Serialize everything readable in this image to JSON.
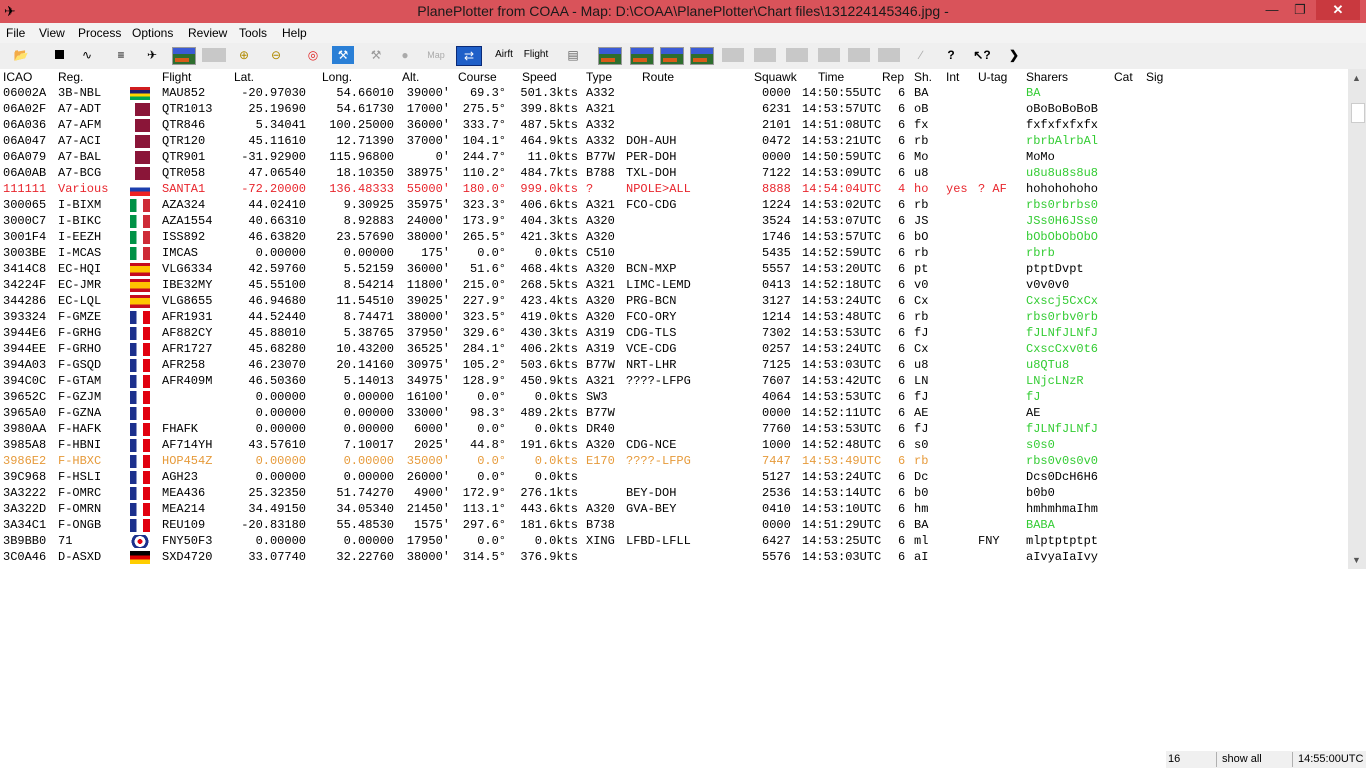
{
  "window": {
    "title": "PlanePlotter from COAA - Map: D:\\COAA\\PlanePlotter\\Chart files\\131224145346.jpg -"
  },
  "menu": [
    "File",
    "View",
    "Process",
    "Options",
    "Review",
    "Tools",
    "Help"
  ],
  "toolbar": {
    "airframe_label": "Airft",
    "flight_label": "Flight",
    "map_label": "Map"
  },
  "columns": [
    "ICAO",
    "Reg.",
    "Flight",
    "Lat.",
    "Long.",
    "Alt.",
    "Course",
    "Speed",
    "Type",
    "Route",
    "Squawk",
    "Time",
    "Rep",
    "Sh.",
    "Int",
    "U-tag",
    "Sharers",
    "Cat",
    "Sig"
  ],
  "colors": {
    "normal": "#000000",
    "red": "#e8262d",
    "orange": "#e69a3a",
    "green": "#33cc33",
    "title_bar": "#d9535a"
  },
  "rows": [
    {
      "icao": "06002A",
      "reg": "3B-NBL",
      "flight": "MAU852",
      "lat": "-20.97030",
      "lon": "54.66010",
      "alt": "39000'",
      "course": "69.3°",
      "speed": "501.3kts",
      "type": "A332",
      "route": "",
      "squawk": "0000",
      "time": "14:50:55UTC",
      "rep": "6",
      "sh": "BA",
      "int": "",
      "utag": "",
      "sharers": "BA",
      "color": "normal",
      "sharers_color": "green",
      "flag": "mauritius"
    },
    {
      "icao": "06A02F",
      "reg": "A7-ADT",
      "flight": "QTR1013",
      "lat": "25.19690",
      "lon": "54.61730",
      "alt": "17000'",
      "course": "275.5°",
      "speed": "399.8kts",
      "type": "A321",
      "route": "",
      "squawk": "6231",
      "time": "14:53:57UTC",
      "rep": "6",
      "sh": "oB",
      "int": "",
      "utag": "",
      "sharers": "oBoBoBoBoB",
      "color": "normal",
      "sharers_color": "normal",
      "flag": "qatar"
    },
    {
      "icao": "06A036",
      "reg": "A7-AFM",
      "flight": "QTR846",
      "lat": "5.34041",
      "lon": "100.25000",
      "alt": "36000'",
      "course": "333.7°",
      "speed": "487.5kts",
      "type": "A332",
      "route": "",
      "squawk": "2101",
      "time": "14:51:08UTC",
      "rep": "6",
      "sh": "fx",
      "int": "",
      "utag": "",
      "sharers": "fxfxfxfxfx",
      "color": "normal",
      "sharers_color": "normal",
      "flag": "qatar"
    },
    {
      "icao": "06A047",
      "reg": "A7-ACI",
      "flight": "QTR120",
      "lat": "45.11610",
      "lon": "12.71390",
      "alt": "37000'",
      "course": "104.1°",
      "speed": "464.9kts",
      "type": "A332",
      "route": "DOH-AUH",
      "squawk": "0472",
      "time": "14:53:21UTC",
      "rep": "6",
      "sh": "rb",
      "int": "",
      "utag": "",
      "sharers": "rbrbAlrbAl",
      "color": "normal",
      "sharers_color": "green",
      "flag": "qatar"
    },
    {
      "icao": "06A079",
      "reg": "A7-BAL",
      "flight": "QTR901",
      "lat": "-31.92900",
      "lon": "115.96800",
      "alt": "0'",
      "course": "244.7°",
      "speed": "11.0kts",
      "type": "B77W",
      "route": "PER-DOH",
      "squawk": "0000",
      "time": "14:50:59UTC",
      "rep": "6",
      "sh": "Mo",
      "int": "",
      "utag": "",
      "sharers": "MoMo",
      "color": "normal",
      "sharers_color": "normal",
      "flag": "qatar"
    },
    {
      "icao": "06A0AB",
      "reg": "A7-BCG",
      "flight": "QTR058",
      "lat": "47.06540",
      "lon": "18.10350",
      "alt": "38975'",
      "course": "110.2°",
      "speed": "484.7kts",
      "type": "B788",
      "route": "TXL-DOH",
      "squawk": "7122",
      "time": "14:53:09UTC",
      "rep": "6",
      "sh": "u8",
      "int": "",
      "utag": "",
      "sharers": "u8u8u8s8u8",
      "color": "normal",
      "sharers_color": "green",
      "flag": "qatar"
    },
    {
      "icao": "111111",
      "reg": "Various",
      "flight": "SANTA1",
      "lat": "-72.20000",
      "lon": "136.48333",
      "alt": "55000'",
      "course": "180.0°",
      "speed": "999.0kts",
      "type": "?",
      "route": "NPOLE>ALL",
      "squawk": "8888",
      "time": "14:54:04UTC",
      "rep": "4",
      "sh": "ho",
      "int": "yes",
      "utag": "? AF",
      "sharers": "hohohohoho",
      "color": "red",
      "sharers_color": "normal",
      "flag": "russia"
    },
    {
      "icao": "300065",
      "reg": "I-BIXM",
      "flight": "AZA324",
      "lat": "44.02410",
      "lon": "9.30925",
      "alt": "35975'",
      "course": "323.3°",
      "speed": "406.6kts",
      "type": "A321",
      "route": "FCO-CDG",
      "squawk": "1224",
      "time": "14:53:02UTC",
      "rep": "6",
      "sh": "rb",
      "int": "",
      "utag": "",
      "sharers": "rbs0rbrbs0",
      "color": "normal",
      "sharers_color": "green",
      "flag": "italy"
    },
    {
      "icao": "3000C7",
      "reg": "I-BIKC",
      "flight": "AZA1554",
      "lat": "40.66310",
      "lon": "8.92883",
      "alt": "24000'",
      "course": "173.9°",
      "speed": "404.3kts",
      "type": "A320",
      "route": "",
      "squawk": "3524",
      "time": "14:53:07UTC",
      "rep": "6",
      "sh": "JS",
      "int": "",
      "utag": "",
      "sharers": "JSs0H6JSs0",
      "color": "normal",
      "sharers_color": "green",
      "flag": "italy"
    },
    {
      "icao": "3001F4",
      "reg": "I-EEZH",
      "flight": "ISS892",
      "lat": "46.63820",
      "lon": "23.57690",
      "alt": "38000'",
      "course": "265.5°",
      "speed": "421.3kts",
      "type": "A320",
      "route": "",
      "squawk": "1746",
      "time": "14:53:57UTC",
      "rep": "6",
      "sh": "bO",
      "int": "",
      "utag": "",
      "sharers": "bObObObObO",
      "color": "normal",
      "sharers_color": "green",
      "flag": "italy"
    },
    {
      "icao": "3003BE",
      "reg": "I-MCAS",
      "flight": "IMCAS",
      "lat": "0.00000",
      "lon": "0.00000",
      "alt": "175'",
      "course": "0.0°",
      "speed": "0.0kts",
      "type": "C510",
      "route": "",
      "squawk": "5435",
      "time": "14:52:59UTC",
      "rep": "6",
      "sh": "rb",
      "int": "",
      "utag": "",
      "sharers": "rbrb",
      "color": "normal",
      "sharers_color": "green",
      "flag": "italy"
    },
    {
      "icao": "3414C8",
      "reg": "EC-HQI",
      "flight": "VLG6334",
      "lat": "42.59760",
      "lon": "5.52159",
      "alt": "36000'",
      "course": "51.6°",
      "speed": "468.4kts",
      "type": "A320",
      "route": "BCN-MXP",
      "squawk": "5557",
      "time": "14:53:20UTC",
      "rep": "6",
      "sh": "pt",
      "int": "",
      "utag": "",
      "sharers": "ptptDvpt",
      "color": "normal",
      "sharers_color": "normal",
      "flag": "spain"
    },
    {
      "icao": "34224F",
      "reg": "EC-JMR",
      "flight": "IBE32MY",
      "lat": "45.55100",
      "lon": "8.54214",
      "alt": "11800'",
      "course": "215.0°",
      "speed": "268.5kts",
      "type": "A321",
      "route": "LIMC-LEMD",
      "squawk": "0413",
      "time": "14:52:18UTC",
      "rep": "6",
      "sh": "v0",
      "int": "",
      "utag": "",
      "sharers": "v0v0v0",
      "color": "normal",
      "sharers_color": "normal",
      "flag": "spain"
    },
    {
      "icao": "344286",
      "reg": "EC-LQL",
      "flight": "VLG8655",
      "lat": "46.94680",
      "lon": "11.54510",
      "alt": "39025'",
      "course": "227.9°",
      "speed": "423.4kts",
      "type": "A320",
      "route": "PRG-BCN",
      "squawk": "3127",
      "time": "14:53:24UTC",
      "rep": "6",
      "sh": "Cx",
      "int": "",
      "utag": "",
      "sharers": "Cxscj5CxCx",
      "color": "normal",
      "sharers_color": "green",
      "flag": "spain"
    },
    {
      "icao": "393324",
      "reg": "F-GMZE",
      "flight": "AFR1931",
      "lat": "44.52440",
      "lon": "8.74471",
      "alt": "38000'",
      "course": "323.5°",
      "speed": "419.0kts",
      "type": "A320",
      "route": "FCO-ORY",
      "squawk": "1214",
      "time": "14:53:48UTC",
      "rep": "6",
      "sh": "rb",
      "int": "",
      "utag": "",
      "sharers": "rbs0rbv0rb",
      "color": "normal",
      "sharers_color": "green",
      "flag": "france"
    },
    {
      "icao": "3944E6",
      "reg": "F-GRHG",
      "flight": "AF882CY",
      "lat": "45.88010",
      "lon": "5.38765",
      "alt": "37950'",
      "course": "329.6°",
      "speed": "430.3kts",
      "type": "A319",
      "route": "CDG-TLS",
      "squawk": "7302",
      "time": "14:53:53UTC",
      "rep": "6",
      "sh": "fJ",
      "int": "",
      "utag": "",
      "sharers": "fJLNfJLNfJ",
      "color": "normal",
      "sharers_color": "green",
      "flag": "france"
    },
    {
      "icao": "3944EE",
      "reg": "F-GRHO",
      "flight": "AFR1727",
      "lat": "45.68280",
      "lon": "10.43200",
      "alt": "36525'",
      "course": "284.1°",
      "speed": "406.2kts",
      "type": "A319",
      "route": "VCE-CDG",
      "squawk": "0257",
      "time": "14:53:24UTC",
      "rep": "6",
      "sh": "Cx",
      "int": "",
      "utag": "",
      "sharers": "CxscCxv0t6",
      "color": "normal",
      "sharers_color": "green",
      "flag": "france"
    },
    {
      "icao": "394A03",
      "reg": "F-GSQD",
      "flight": "AFR258",
      "lat": "46.23070",
      "lon": "20.14160",
      "alt": "30975'",
      "course": "105.2°",
      "speed": "503.6kts",
      "type": "B77W",
      "route": "NRT-LHR",
      "squawk": "7125",
      "time": "14:53:03UTC",
      "rep": "6",
      "sh": "u8",
      "int": "",
      "utag": "",
      "sharers": "u8QTu8",
      "color": "normal",
      "sharers_color": "green",
      "flag": "france"
    },
    {
      "icao": "394C0C",
      "reg": "F-GTAM",
      "flight": "AFR409M",
      "lat": "46.50360",
      "lon": "5.14013",
      "alt": "34975'",
      "course": "128.9°",
      "speed": "450.9kts",
      "type": "A321",
      "route": "????-LFPG",
      "squawk": "7607",
      "time": "14:53:42UTC",
      "rep": "6",
      "sh": "LN",
      "int": "",
      "utag": "",
      "sharers": "LNjcLNzR",
      "color": "normal",
      "sharers_color": "green",
      "flag": "france"
    },
    {
      "icao": "39652C",
      "reg": "F-GZJM",
      "flight": "",
      "lat": "0.00000",
      "lon": "0.00000",
      "alt": "16100'",
      "course": "0.0°",
      "speed": "0.0kts",
      "type": "SW3",
      "route": "",
      "squawk": "4064",
      "time": "14:53:53UTC",
      "rep": "6",
      "sh": "fJ",
      "int": "",
      "utag": "",
      "sharers": "fJ",
      "color": "normal",
      "sharers_color": "green",
      "flag": "france"
    },
    {
      "icao": "3965A0",
      "reg": "F-GZNA",
      "flight": "",
      "lat": "0.00000",
      "lon": "0.00000",
      "alt": "33000'",
      "course": "98.3°",
      "speed": "489.2kts",
      "type": "B77W",
      "route": "",
      "squawk": "0000",
      "time": "14:52:11UTC",
      "rep": "6",
      "sh": "AE",
      "int": "",
      "utag": "",
      "sharers": "AE",
      "color": "normal",
      "sharers_color": "normal",
      "flag": "france"
    },
    {
      "icao": "3980AA",
      "reg": "F-HAFK",
      "flight": "FHAFK",
      "lat": "0.00000",
      "lon": "0.00000",
      "alt": "6000'",
      "course": "0.0°",
      "speed": "0.0kts",
      "type": "DR40",
      "route": "",
      "squawk": "7760",
      "time": "14:53:53UTC",
      "rep": "6",
      "sh": "fJ",
      "int": "",
      "utag": "",
      "sharers": "fJLNfJLNfJ",
      "color": "normal",
      "sharers_color": "green",
      "flag": "france"
    },
    {
      "icao": "3985A8",
      "reg": "F-HBNI",
      "flight": "AF714YH",
      "lat": "43.57610",
      "lon": "7.10017",
      "alt": "2025'",
      "course": "44.8°",
      "speed": "191.6kts",
      "type": "A320",
      "route": "CDG-NCE",
      "squawk": "1000",
      "time": "14:52:48UTC",
      "rep": "6",
      "sh": "s0",
      "int": "",
      "utag": "",
      "sharers": "s0s0",
      "color": "normal",
      "sharers_color": "green",
      "flag": "france"
    },
    {
      "icao": "3986E2",
      "reg": "F-HBXC",
      "flight": "HOP454Z",
      "lat": "0.00000",
      "lon": "0.00000",
      "alt": "35000'",
      "course": "0.0°",
      "speed": "0.0kts",
      "type": "E170",
      "route": "????-LFPG",
      "squawk": "7447",
      "time": "14:53:49UTC",
      "rep": "6",
      "sh": "rb",
      "int": "",
      "utag": "",
      "sharers": "rbs0v0s0v0",
      "color": "orange",
      "sharers_color": "green",
      "flag": "france"
    },
    {
      "icao": "39C968",
      "reg": "F-HSLI",
      "flight": "AGH23",
      "lat": "0.00000",
      "lon": "0.00000",
      "alt": "26000'",
      "course": "0.0°",
      "speed": "0.0kts",
      "type": "",
      "route": "",
      "squawk": "5127",
      "time": "14:53:24UTC",
      "rep": "6",
      "sh": "Dc",
      "int": "",
      "utag": "",
      "sharers": "Dcs0DcH6H6",
      "color": "normal",
      "sharers_color": "normal",
      "flag": "france"
    },
    {
      "icao": "3A3222",
      "reg": "F-OMRC",
      "flight": "MEA436",
      "lat": "25.32350",
      "lon": "51.74270",
      "alt": "4900'",
      "course": "172.9°",
      "speed": "276.1kts",
      "type": "",
      "route": "BEY-DOH",
      "squawk": "2536",
      "time": "14:53:14UTC",
      "rep": "6",
      "sh": "b0",
      "int": "",
      "utag": "",
      "sharers": "b0b0",
      "color": "normal",
      "sharers_color": "normal",
      "flag": "france"
    },
    {
      "icao": "3A322D",
      "reg": "F-OMRN",
      "flight": "MEA214",
      "lat": "34.49150",
      "lon": "34.05340",
      "alt": "21450'",
      "course": "113.1°",
      "speed": "443.6kts",
      "type": "A320",
      "route": "GVA-BEY",
      "squawk": "0410",
      "time": "14:53:10UTC",
      "rep": "6",
      "sh": "hm",
      "int": "",
      "utag": "",
      "sharers": "hmhmhmaIhm",
      "color": "normal",
      "sharers_color": "normal",
      "flag": "france"
    },
    {
      "icao": "3A34C1",
      "reg": "F-ONGB",
      "flight": "REU109",
      "lat": "-20.83180",
      "lon": "55.48530",
      "alt": "1575'",
      "course": "297.6°",
      "speed": "181.6kts",
      "type": "B738",
      "route": "",
      "squawk": "0000",
      "time": "14:51:29UTC",
      "rep": "6",
      "sh": "BA",
      "int": "",
      "utag": "",
      "sharers": "BABA",
      "color": "normal",
      "sharers_color": "green",
      "flag": "france"
    },
    {
      "icao": "3B9BB0",
      "reg": "71",
      "flight": "FNY50F3",
      "lat": "0.00000",
      "lon": "0.00000",
      "alt": "17950'",
      "course": "0.0°",
      "speed": "0.0kts",
      "type": "XING",
      "route": "LFBD-LFLL",
      "squawk": "6427",
      "time": "14:53:25UTC",
      "rep": "6",
      "sh": "ml",
      "int": "",
      "utag": "FNY",
      "sharers": "mlptptptpt",
      "color": "normal",
      "sharers_color": "normal",
      "flag": "roundel"
    },
    {
      "icao": "3C0A46",
      "reg": "D-ASXD",
      "flight": "SXD4720",
      "lat": "33.07740",
      "lon": "32.22760",
      "alt": "38000'",
      "course": "314.5°",
      "speed": "376.9kts",
      "type": "",
      "route": "",
      "squawk": "5576",
      "time": "14:53:03UTC",
      "rep": "6",
      "sh": "aI",
      "int": "",
      "utag": "",
      "sharers": "aIvyaIaIvy",
      "color": "normal",
      "sharers_color": "normal",
      "flag": "germany"
    }
  ],
  "status": {
    "count": "16",
    "filter": "show all",
    "clock": "14:55:00UTC"
  }
}
